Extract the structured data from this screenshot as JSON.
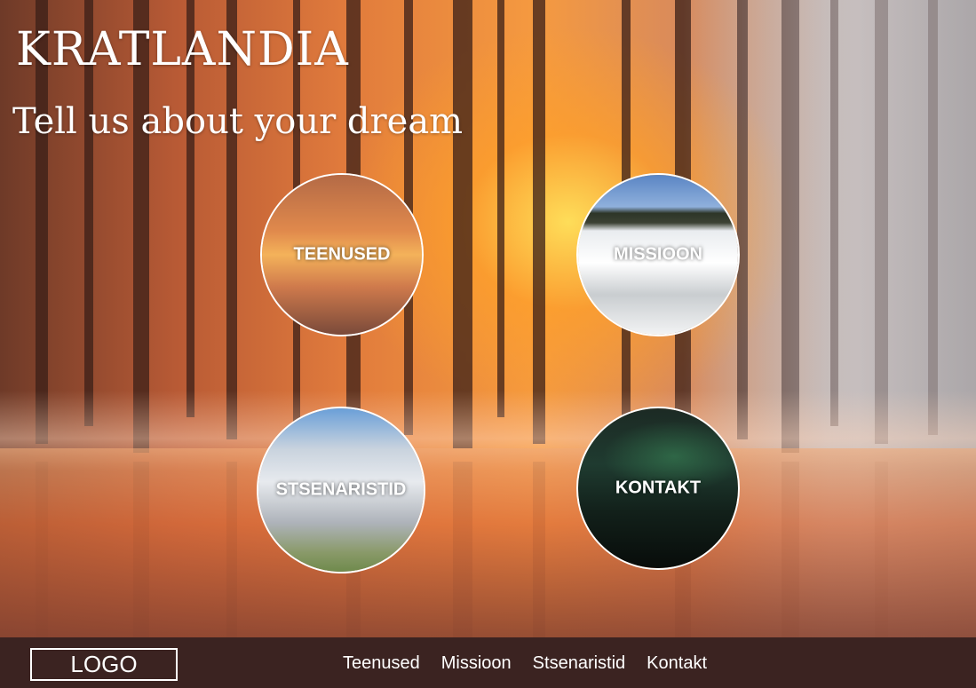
{
  "header": {
    "site_title": "KRATLANDIA",
    "tagline": "Tell us about your dream"
  },
  "tiles": [
    {
      "label": "TEENUSED",
      "image": "sunset-forest-reflection"
    },
    {
      "label": "MISSIOON",
      "image": "misty-snowy-bog"
    },
    {
      "label": "STSENARISTID",
      "image": "frosted-trees-blue-sky"
    },
    {
      "label": "KONTAKT",
      "image": "northern-lights-night"
    }
  ],
  "footer": {
    "logo": "LOGO",
    "nav": [
      "Teenused",
      "Missioon",
      "Stsenaristid",
      "Kontakt"
    ]
  },
  "colors": {
    "footer_bg": "#3b2321",
    "text": "#ffffff",
    "accent_orange": "#f59a40"
  },
  "background_image": "autumn-winter-forest-sunset-over-water"
}
